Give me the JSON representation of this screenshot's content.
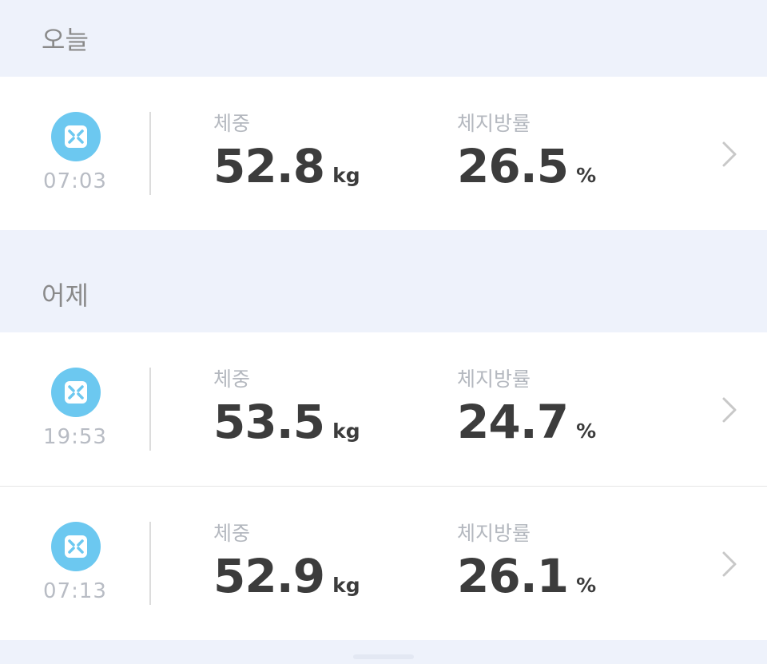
{
  "sections": [
    {
      "title": "오늘",
      "records": [
        {
          "time": "07:03",
          "weight_label": "체중",
          "weight_value": "52.8",
          "weight_unit": "kg",
          "fat_label": "체지방률",
          "fat_value": "26.5",
          "fat_unit": "%"
        }
      ]
    },
    {
      "title": "어제",
      "records": [
        {
          "time": "19:53",
          "weight_label": "체중",
          "weight_value": "53.5",
          "weight_unit": "kg",
          "fat_label": "체지방률",
          "fat_value": "24.7",
          "fat_unit": "%"
        },
        {
          "time": "07:13",
          "weight_label": "체중",
          "weight_value": "52.9",
          "weight_unit": "kg",
          "fat_label": "체지방률",
          "fat_value": "26.1",
          "fat_unit": "%"
        }
      ]
    }
  ],
  "icons": {
    "device": "scale-icon",
    "chevron": "chevron-right-icon"
  },
  "colors": {
    "accent": "#6cc8f0",
    "background": "#eef2fb",
    "value_text": "#3c3c3c",
    "label_text": "#b4b8bf"
  }
}
